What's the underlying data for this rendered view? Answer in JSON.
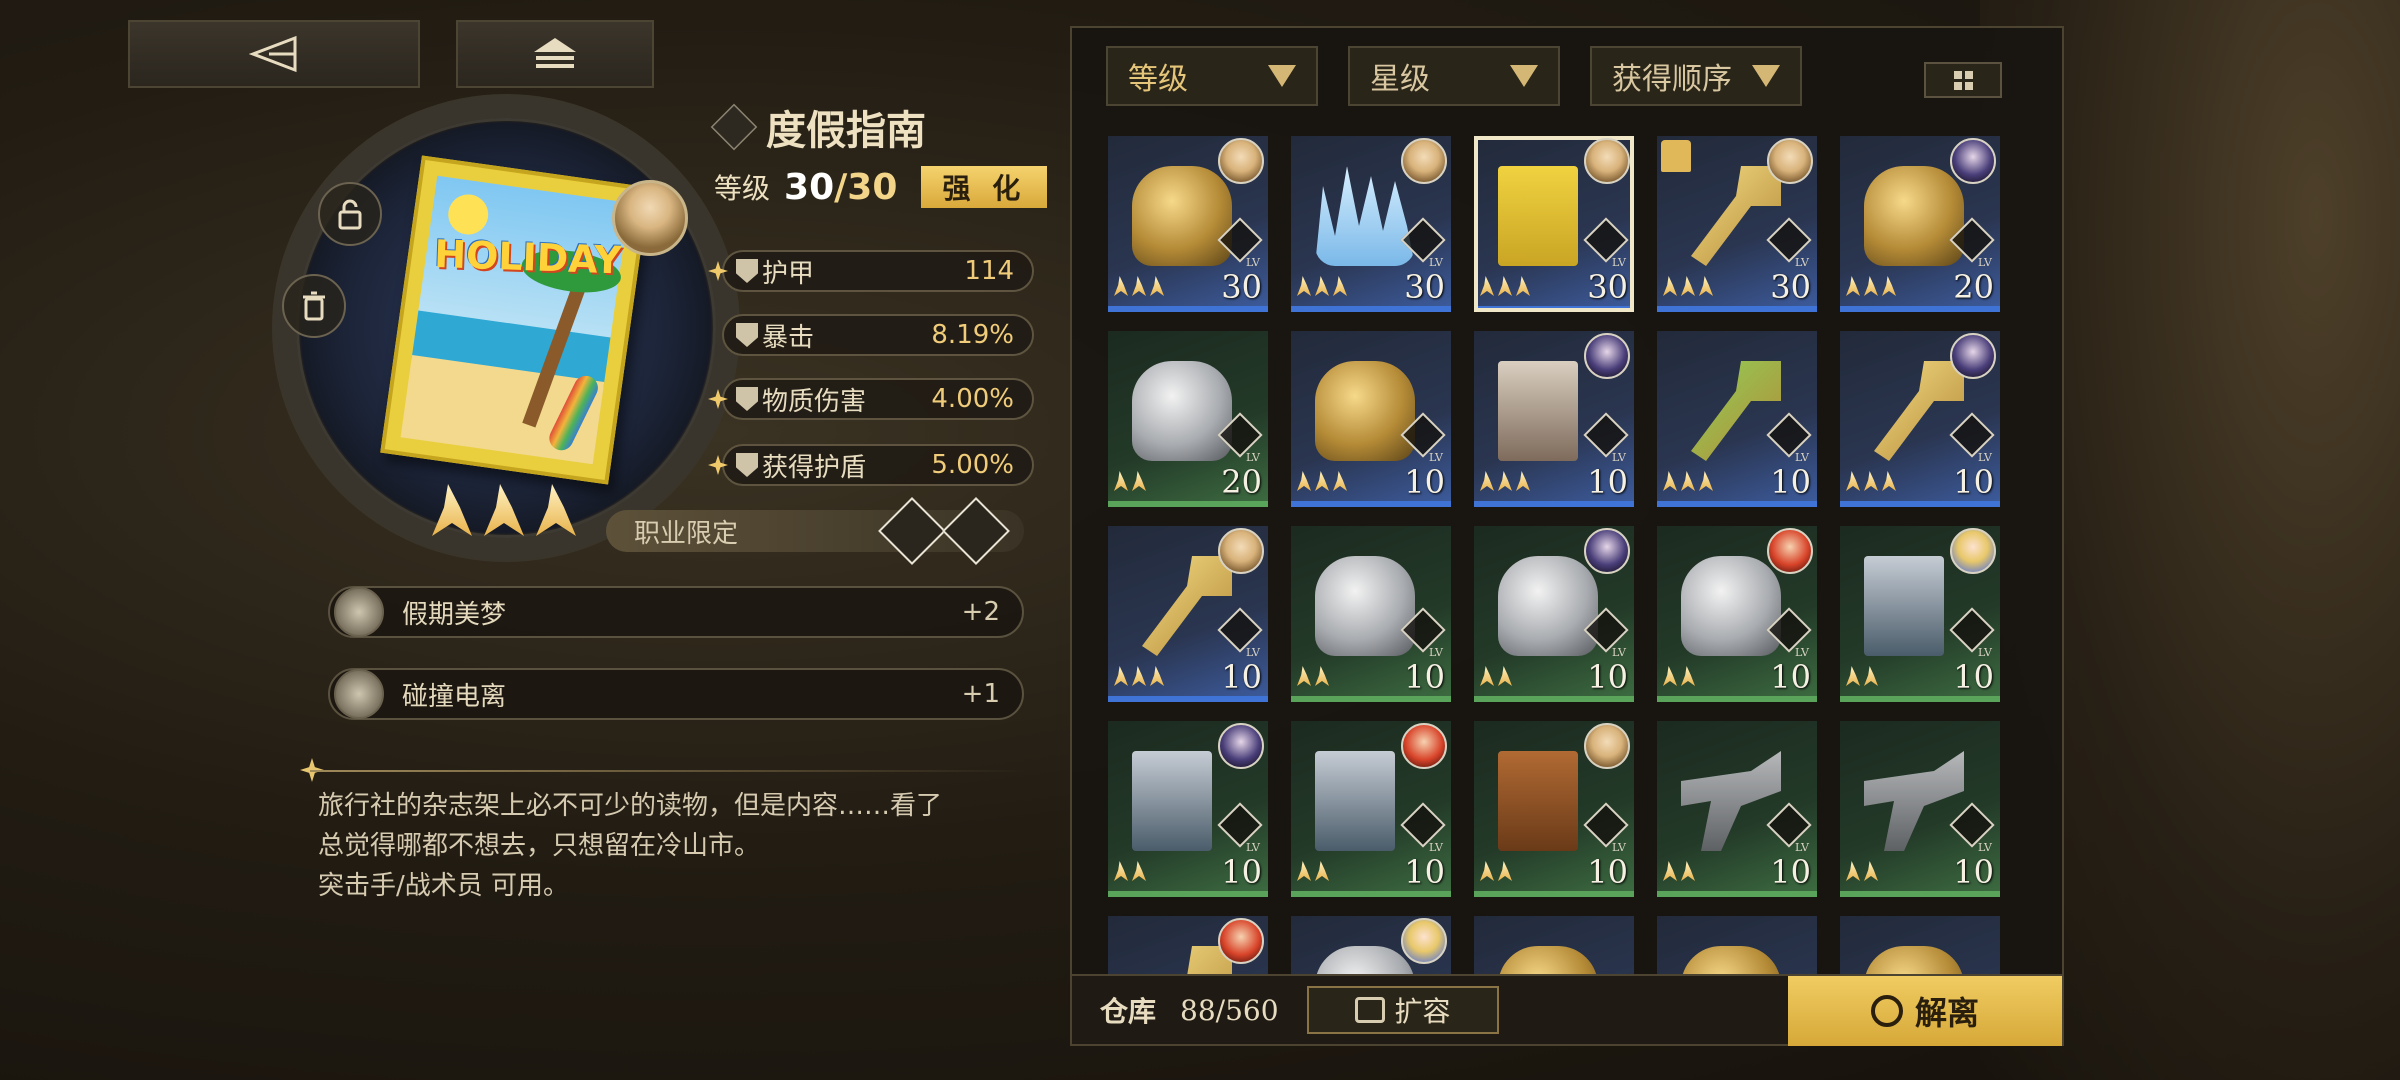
{
  "item": {
    "name": "度假指南",
    "level_label": "等级",
    "level_current": "30",
    "level_max": "/30",
    "enhance_label": "强 化",
    "art_text": "HOLIDAY",
    "stars": 3
  },
  "stats": [
    {
      "name": "护甲",
      "value": "114",
      "highlight": true
    },
    {
      "name": "暴击",
      "value": "8.19%",
      "highlight": false
    },
    {
      "name": "物质伤害",
      "value": "4.00%",
      "highlight": true
    },
    {
      "name": "获得护盾",
      "value": "5.00%",
      "highlight": true
    }
  ],
  "job_limit_label": "职业限定",
  "skills": [
    {
      "name": "假期美梦",
      "level": "+2"
    },
    {
      "name": "碰撞电离",
      "level": "+1"
    }
  ],
  "description": [
    "旅行社的杂志架上必不可少的读物，但是内容……看了",
    "总觉得哪都不想去，只想留在冷山市。",
    "突击手/战术员 可用。"
  ],
  "filters": [
    {
      "label": "等级"
    },
    {
      "label": "星级"
    },
    {
      "label": "获得顺序"
    }
  ],
  "inventory": [
    {
      "art": "gold",
      "avatar": "a",
      "level": "30",
      "stars": 3,
      "rarity": "blue"
    },
    {
      "art": "ice",
      "avatar": "a",
      "level": "30",
      "stars": 3,
      "rarity": "blue"
    },
    {
      "art": "book",
      "avatar": "a",
      "level": "30",
      "stars": 3,
      "rarity": "blue",
      "selected": true
    },
    {
      "art": "key",
      "avatar": "a",
      "level": "30",
      "stars": 3,
      "rarity": "blue",
      "locked": true
    },
    {
      "art": "gold",
      "avatar": "b",
      "level": "20",
      "stars": 3,
      "rarity": "blue"
    },
    {
      "art": "silver",
      "avatar": "",
      "level": "20",
      "stars": 2,
      "rarity": "green"
    },
    {
      "art": "gold",
      "avatar": "",
      "level": "10",
      "stars": 3,
      "rarity": "blue"
    },
    {
      "art": "photo",
      "avatar": "b",
      "level": "10",
      "stars": 3,
      "rarity": "blue"
    },
    {
      "art": "keygreen",
      "avatar": "",
      "level": "10",
      "stars": 3,
      "rarity": "blue"
    },
    {
      "art": "key",
      "avatar": "b",
      "level": "10",
      "stars": 3,
      "rarity": "blue"
    },
    {
      "art": "key",
      "avatar": "a",
      "level": "10",
      "stars": 3,
      "rarity": "blue"
    },
    {
      "art": "silver",
      "avatar": "",
      "level": "10",
      "stars": 2,
      "rarity": "green"
    },
    {
      "art": "silver",
      "avatar": "b",
      "level": "10",
      "stars": 2,
      "rarity": "green"
    },
    {
      "art": "silver",
      "avatar": "c",
      "level": "10",
      "stars": 2,
      "rarity": "green"
    },
    {
      "art": "poster",
      "avatar": "d",
      "level": "10",
      "stars": 2,
      "rarity": "green"
    },
    {
      "art": "poster",
      "avatar": "b",
      "level": "10",
      "stars": 2,
      "rarity": "green"
    },
    {
      "art": "poster",
      "avatar": "c",
      "level": "10",
      "stars": 2,
      "rarity": "green"
    },
    {
      "art": "tome",
      "avatar": "a",
      "level": "10",
      "stars": 2,
      "rarity": "green"
    },
    {
      "art": "pistol",
      "avatar": "",
      "level": "10",
      "stars": 2,
      "rarity": "green"
    },
    {
      "art": "pistol",
      "avatar": "",
      "level": "10",
      "stars": 2,
      "rarity": "green"
    },
    {
      "art": "key",
      "avatar": "c",
      "level": "",
      "stars": 0,
      "rarity": "blue"
    },
    {
      "art": "silver",
      "avatar": "d",
      "level": "",
      "stars": 0,
      "rarity": "blue"
    },
    {
      "art": "gold",
      "avatar": "",
      "level": "",
      "stars": 0,
      "rarity": "blue"
    },
    {
      "art": "gold",
      "avatar": "",
      "level": "",
      "stars": 0,
      "rarity": "blue"
    },
    {
      "art": "gold",
      "avatar": "",
      "level": "",
      "stars": 0,
      "rarity": "blue"
    }
  ],
  "storage": {
    "label": "仓库",
    "count": "88/560",
    "expand_label": "扩容",
    "dismantle_label": "解离"
  },
  "lv_tag": "LV",
  "colors": {
    "accent_gold": "#e0b85a",
    "rarity_blue": "#3f74d6",
    "rarity_green": "#5aa35a"
  }
}
